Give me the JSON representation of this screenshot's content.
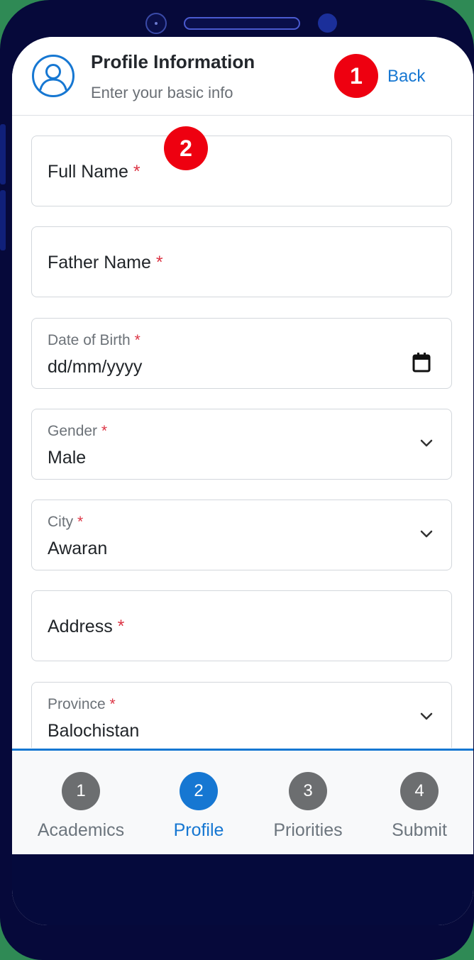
{
  "header": {
    "title": "Profile Information",
    "subtitle": "Enter your basic info",
    "back_label": "Back",
    "icon": "user-circle-icon"
  },
  "annotations": [
    "1",
    "2"
  ],
  "form": {
    "required_mark": "*",
    "full_name": {
      "label": "Full Name"
    },
    "father_name": {
      "label": "Father Name"
    },
    "dob": {
      "label": "Date of Birth",
      "placeholder": "dd/mm/yyyy",
      "icon": "calendar-icon"
    },
    "gender": {
      "label": "Gender",
      "value": "Male",
      "icon": "chevron-down-icon"
    },
    "city": {
      "label": "City",
      "value": "Awaran",
      "icon": "chevron-down-icon"
    },
    "address": {
      "label": "Address"
    },
    "province": {
      "label": "Province",
      "value": "Balochistan",
      "icon": "chevron-down-icon"
    }
  },
  "stepper": {
    "active_step": 2,
    "steps": [
      {
        "number": "1",
        "label": "Academics"
      },
      {
        "number": "2",
        "label": "Profile"
      },
      {
        "number": "3",
        "label": "Priorities"
      },
      {
        "number": "4",
        "label": "Submit"
      }
    ]
  },
  "colors": {
    "accent": "#1677d2",
    "required": "#dc3545",
    "badge": "#ee0010",
    "phone_frame": "#06093a",
    "background": "#2f8a55"
  }
}
